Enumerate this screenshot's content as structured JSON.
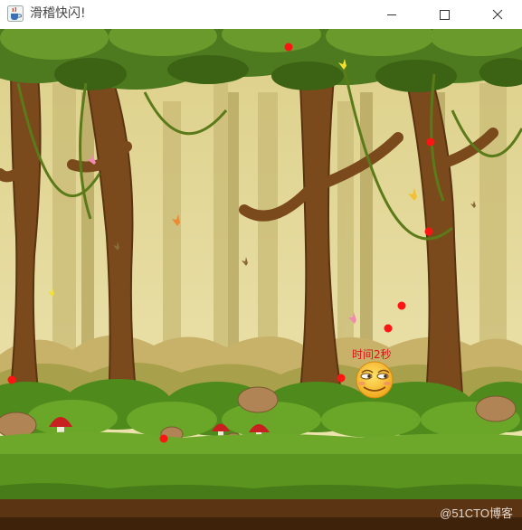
{
  "window": {
    "title": "滑稽快闪!",
    "icon": "java-cup-icon",
    "controls": [
      "minimize-icon",
      "maximize-icon",
      "close-icon"
    ]
  },
  "game": {
    "timer_text": "时间2秒",
    "player": "smug-smiley-face",
    "bullet_color": "#ff1a1a",
    "bullet_count": 10,
    "scene": "cartoon-forest"
  },
  "watermark": "@51CTO博客",
  "colors": {
    "sky": "#e8dc9a",
    "tree_trunk": "#7a4a1e",
    "canopy": "#4e7a1f",
    "grass": "#6aa628",
    "soil": "#5a3413"
  }
}
